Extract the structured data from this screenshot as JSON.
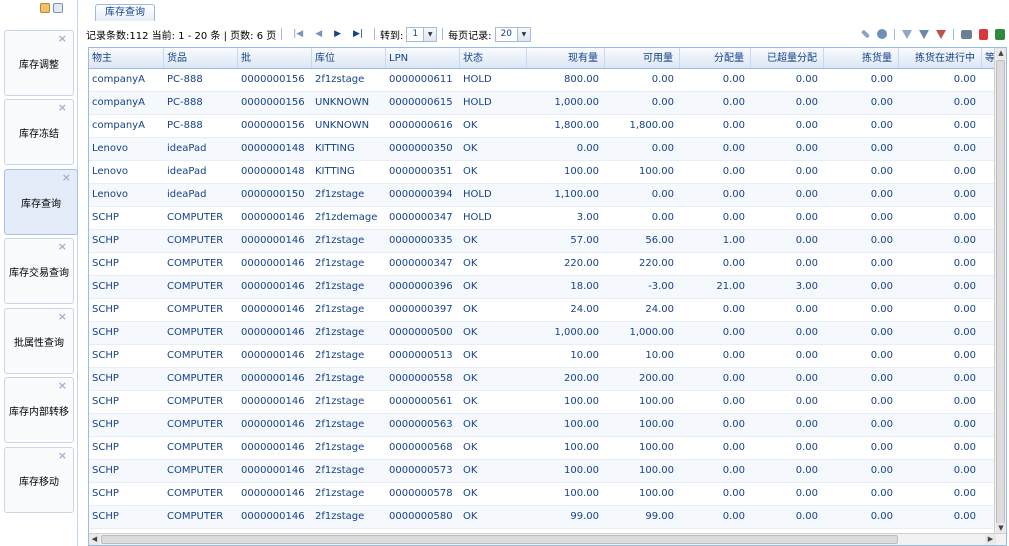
{
  "leftnav": {
    "items": [
      {
        "label": "库存调整",
        "close": "×",
        "active": false
      },
      {
        "label": "库存冻结",
        "close": "×",
        "active": false
      },
      {
        "label": "库存查询",
        "close": "×",
        "active": true
      },
      {
        "label": "库存交易查询",
        "close": "×",
        "active": false
      },
      {
        "label": "批属性查询",
        "close": "×",
        "active": false
      },
      {
        "label": "库存内部转移",
        "close": "×",
        "active": false
      },
      {
        "label": "库存移动",
        "close": "×",
        "active": false
      }
    ]
  },
  "tab": {
    "label": "库存查询"
  },
  "toolbar": {
    "summary": "记录条数:112 当前: 1 - 20 条 | 页数: 6 页",
    "goto_label": "转到:",
    "goto_value": "1",
    "pagesize_label": "每页记录:",
    "pagesize_value": "20"
  },
  "grid": {
    "columns": [
      "物主",
      "货品",
      "批",
      "库位",
      "LPN",
      "状态",
      "现有量",
      "可用量",
      "分配量",
      "已超量分配",
      "拣货量",
      "拣货在进行中",
      "等"
    ],
    "rows": [
      [
        "companyA",
        "PC-888",
        "0000000156",
        "2f1zstage",
        "0000000611",
        "HOLD",
        "800.00",
        "0.00",
        "0.00",
        "0.00",
        "0.00",
        "0.00"
      ],
      [
        "companyA",
        "PC-888",
        "0000000156",
        "UNKNOWN",
        "0000000615",
        "HOLD",
        "1,000.00",
        "0.00",
        "0.00",
        "0.00",
        "0.00",
        "0.00"
      ],
      [
        "companyA",
        "PC-888",
        "0000000156",
        "UNKNOWN",
        "0000000616",
        "OK",
        "1,800.00",
        "1,800.00",
        "0.00",
        "0.00",
        "0.00",
        "0.00"
      ],
      [
        "Lenovo",
        "ideaPad",
        "0000000148",
        "KITTING",
        "0000000350",
        "OK",
        "0.00",
        "0.00",
        "0.00",
        "0.00",
        "0.00",
        "0.00"
      ],
      [
        "Lenovo",
        "ideaPad",
        "0000000148",
        "KITTING",
        "0000000351",
        "OK",
        "100.00",
        "100.00",
        "0.00",
        "0.00",
        "0.00",
        "0.00"
      ],
      [
        "Lenovo",
        "ideaPad",
        "0000000150",
        "2f1zstage",
        "0000000394",
        "HOLD",
        "1,100.00",
        "0.00",
        "0.00",
        "0.00",
        "0.00",
        "0.00"
      ],
      [
        "SCHP",
        "COMPUTER",
        "0000000146",
        "2f1zdemage",
        "0000000347",
        "HOLD",
        "3.00",
        "0.00",
        "0.00",
        "0.00",
        "0.00",
        "0.00"
      ],
      [
        "SCHP",
        "COMPUTER",
        "0000000146",
        "2f1zstage",
        "0000000335",
        "OK",
        "57.00",
        "56.00",
        "1.00",
        "0.00",
        "0.00",
        "0.00"
      ],
      [
        "SCHP",
        "COMPUTER",
        "0000000146",
        "2f1zstage",
        "0000000347",
        "OK",
        "220.00",
        "220.00",
        "0.00",
        "0.00",
        "0.00",
        "0.00"
      ],
      [
        "SCHP",
        "COMPUTER",
        "0000000146",
        "2f1zstage",
        "0000000396",
        "OK",
        "18.00",
        "-3.00",
        "21.00",
        "3.00",
        "0.00",
        "0.00"
      ],
      [
        "SCHP",
        "COMPUTER",
        "0000000146",
        "2f1zstage",
        "0000000397",
        "OK",
        "24.00",
        "24.00",
        "0.00",
        "0.00",
        "0.00",
        "0.00"
      ],
      [
        "SCHP",
        "COMPUTER",
        "0000000146",
        "2f1zstage",
        "0000000500",
        "OK",
        "1,000.00",
        "1,000.00",
        "0.00",
        "0.00",
        "0.00",
        "0.00"
      ],
      [
        "SCHP",
        "COMPUTER",
        "0000000146",
        "2f1zstage",
        "0000000513",
        "OK",
        "10.00",
        "10.00",
        "0.00",
        "0.00",
        "0.00",
        "0.00"
      ],
      [
        "SCHP",
        "COMPUTER",
        "0000000146",
        "2f1zstage",
        "0000000558",
        "OK",
        "200.00",
        "200.00",
        "0.00",
        "0.00",
        "0.00",
        "0.00"
      ],
      [
        "SCHP",
        "COMPUTER",
        "0000000146",
        "2f1zstage",
        "0000000561",
        "OK",
        "100.00",
        "100.00",
        "0.00",
        "0.00",
        "0.00",
        "0.00"
      ],
      [
        "SCHP",
        "COMPUTER",
        "0000000146",
        "2f1zstage",
        "0000000563",
        "OK",
        "100.00",
        "100.00",
        "0.00",
        "0.00",
        "0.00",
        "0.00"
      ],
      [
        "SCHP",
        "COMPUTER",
        "0000000146",
        "2f1zstage",
        "0000000568",
        "OK",
        "100.00",
        "100.00",
        "0.00",
        "0.00",
        "0.00",
        "0.00"
      ],
      [
        "SCHP",
        "COMPUTER",
        "0000000146",
        "2f1zstage",
        "0000000573",
        "OK",
        "100.00",
        "100.00",
        "0.00",
        "0.00",
        "0.00",
        "0.00"
      ],
      [
        "SCHP",
        "COMPUTER",
        "0000000146",
        "2f1zstage",
        "0000000578",
        "OK",
        "100.00",
        "100.00",
        "0.00",
        "0.00",
        "0.00",
        "0.00"
      ],
      [
        "SCHP",
        "COMPUTER",
        "0000000146",
        "2f1zstage",
        "0000000580",
        "OK",
        "99.00",
        "99.00",
        "0.00",
        "0.00",
        "0.00",
        "0.00"
      ]
    ]
  },
  "icons": {
    "nav_top": [
      "save-icon",
      "panel-toggle-icon"
    ],
    "toolbar_right": [
      "wrench-icon",
      "refresh-icon",
      "filter-icon",
      "advanced-filter-icon",
      "clear-filter-icon",
      "print-icon",
      "export-pdf-icon",
      "export-excel-icon"
    ]
  },
  "colors": {
    "header_text": "#15428b",
    "border": "#99bbe8",
    "active_nav": "#e3ecf8"
  }
}
